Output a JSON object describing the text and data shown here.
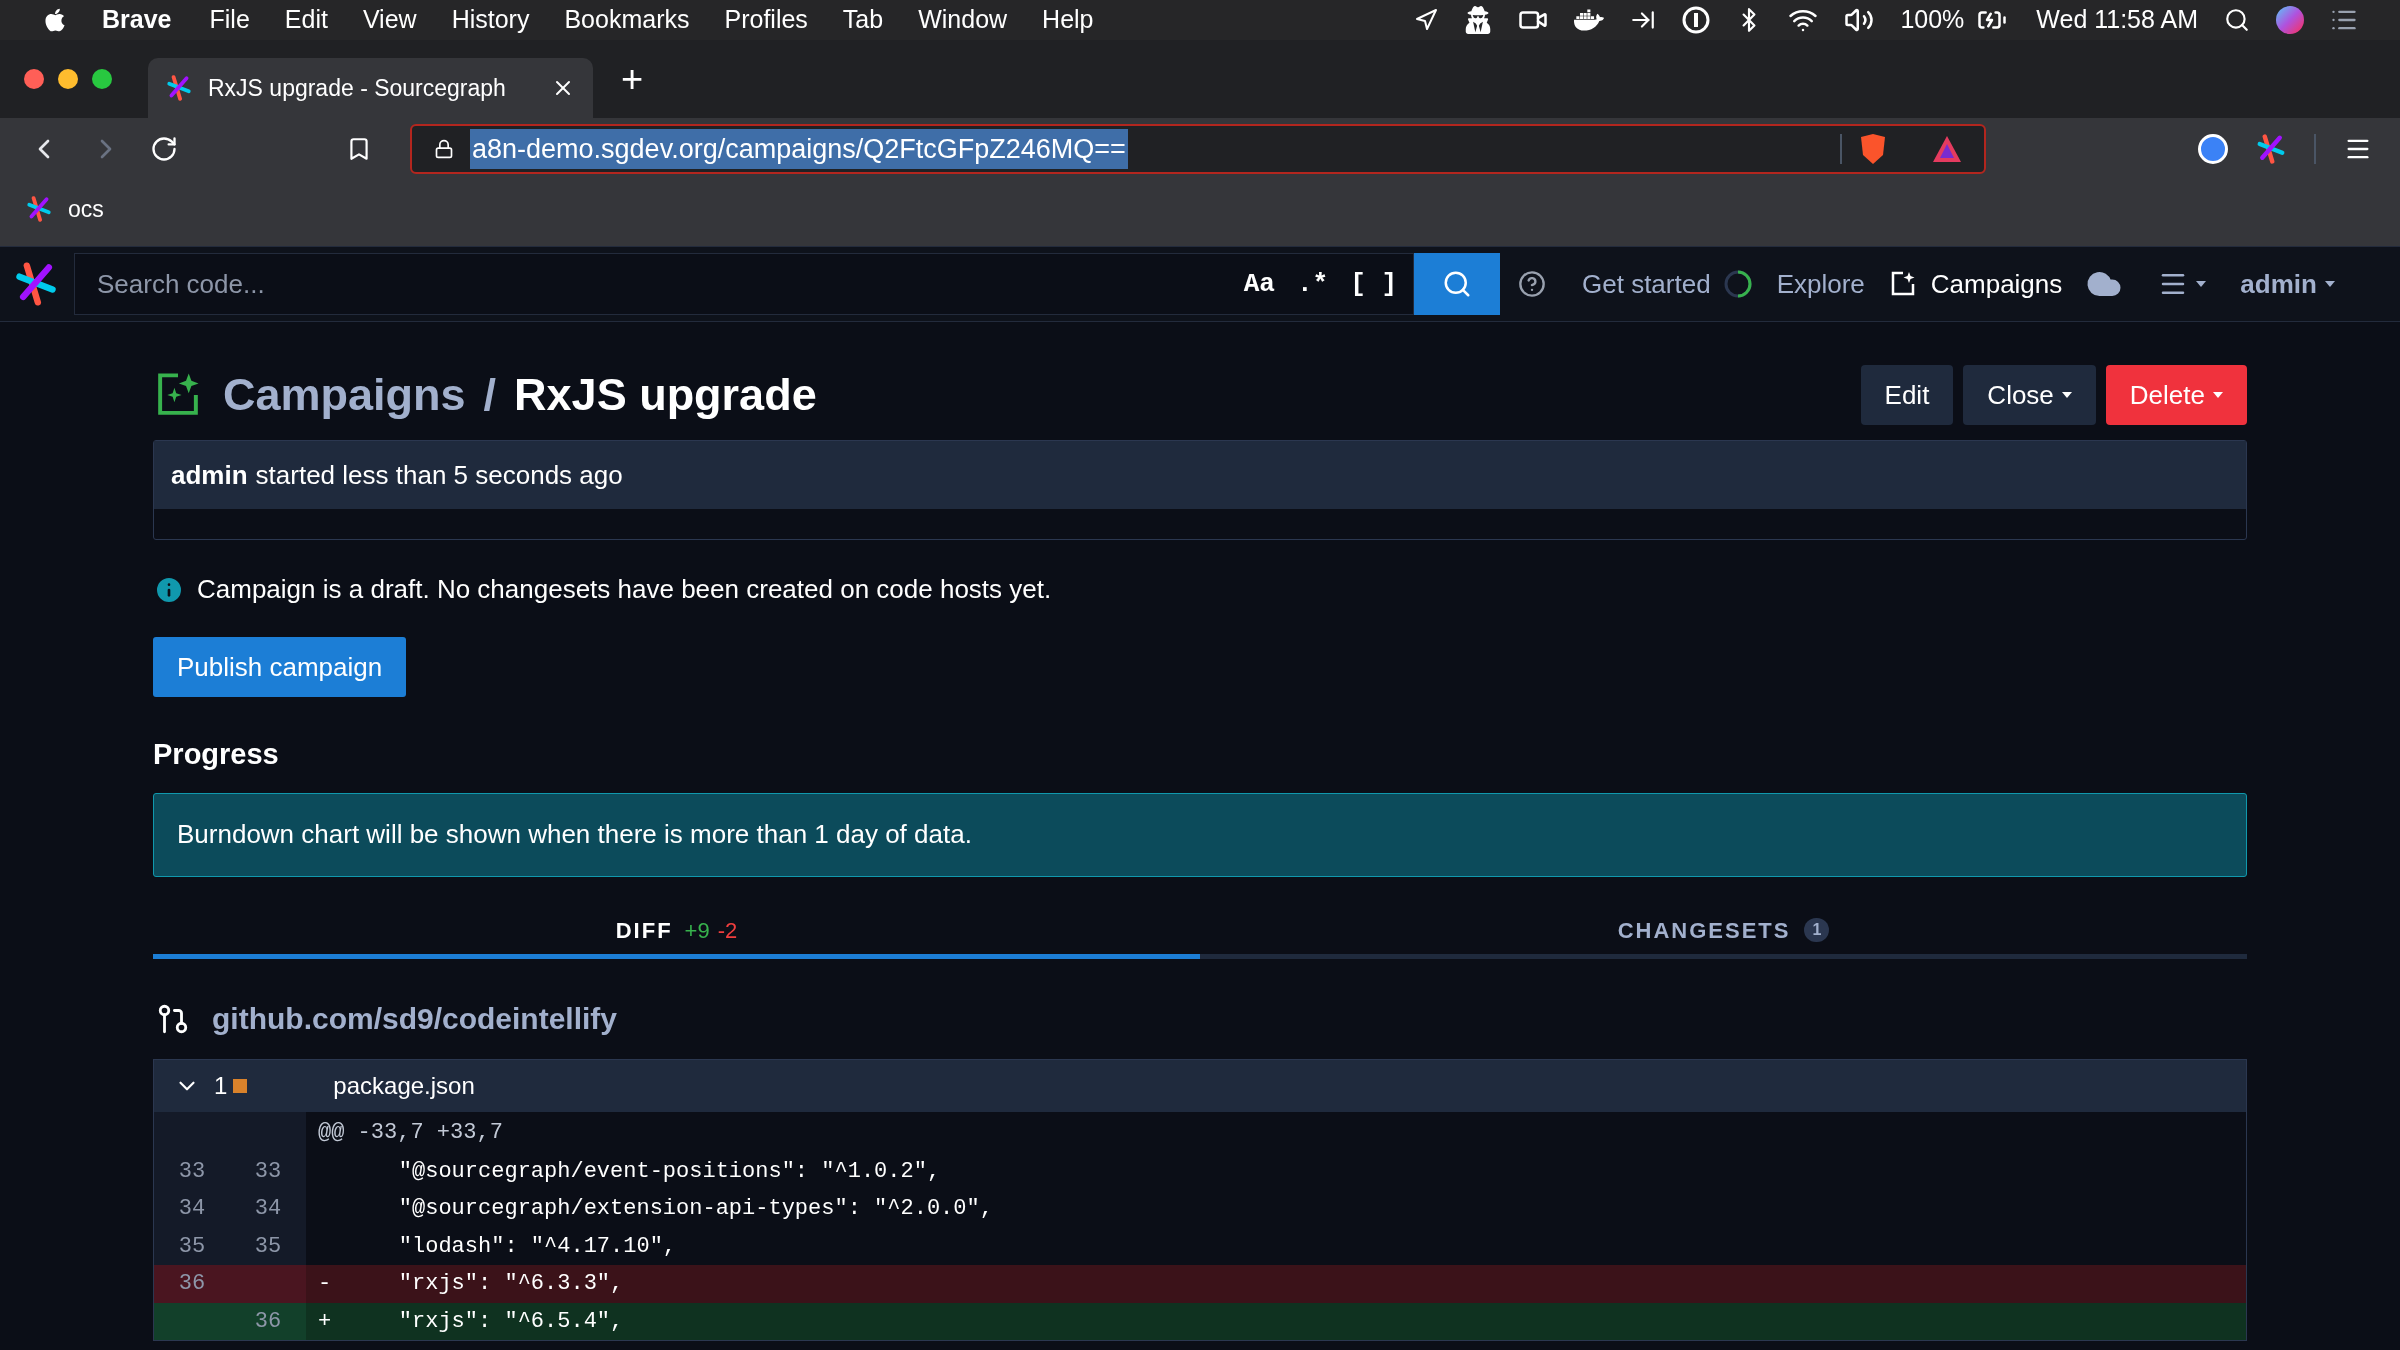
{
  "menubar": {
    "app": "Brave",
    "menus": [
      "File",
      "Edit",
      "View",
      "History",
      "Bookmarks",
      "Profiles",
      "Tab",
      "Window",
      "Help"
    ],
    "battery": "100%",
    "clock": "Wed 11:58 AM"
  },
  "browser": {
    "tab_title": "RxJS upgrade - Sourcegraph",
    "new_tab": "+",
    "url": "a8n-demo.sgdev.org/campaigns/Q2FtcGFpZ246MQ==",
    "bookmarks": [
      "ocs"
    ]
  },
  "nav": {
    "search": {
      "placeholder": "Search code..."
    },
    "toggles": [
      "Aa",
      ".*",
      "[ ]"
    ],
    "links": [
      "Get started",
      "Explore",
      "Campaigns"
    ],
    "user": "admin"
  },
  "header": {
    "breadcrumb": "Campaigns",
    "separator": "/",
    "title": "RxJS upgrade",
    "buttons": [
      {
        "label": "Edit",
        "kind": "plain"
      },
      {
        "label": "Close",
        "kind": "dropdown"
      },
      {
        "label": "Delete",
        "kind": "danger"
      }
    ]
  },
  "banner": {
    "author": "admin",
    "text": "started less than 5 seconds ago"
  },
  "info": "Campaign is a draft. No changesets have been created on code hosts yet.",
  "publish_button": "Publish campaign",
  "progress": {
    "heading": "Progress",
    "alert": "Burndown chart will be shown when there is more than 1 day of data."
  },
  "tabs": [
    {
      "label": "DIFF",
      "added": "+9",
      "removed": "-2",
      "selected": true
    },
    {
      "label": "CHANGESETS",
      "count": "1",
      "selected": false
    }
  ],
  "repo": "github.com/sd9/codeintellify",
  "file": {
    "expanded": true,
    "count": "1",
    "name": "package.json",
    "hunk": "@@ -33,7 +33,7",
    "lines": [
      {
        "kind": "context",
        "old": "33",
        "new": "33",
        "text": "    \"@sourcegraph/event-positions\": \"^1.0.2\","
      },
      {
        "kind": "context",
        "old": "34",
        "new": "34",
        "text": "    \"@sourcegraph/extension-api-types\": \"^2.0.0\","
      },
      {
        "kind": "context",
        "old": "35",
        "new": "35",
        "text": "    \"lodash\": \"^4.17.10\","
      },
      {
        "kind": "removed",
        "old": "36",
        "sign": "-",
        "text": "    \"rxjs\": \"^6.3.3\","
      },
      {
        "kind": "added",
        "new": "36",
        "sign": "+",
        "text": "    \"rxjs\": \"^6.5.4\","
      }
    ]
  }
}
